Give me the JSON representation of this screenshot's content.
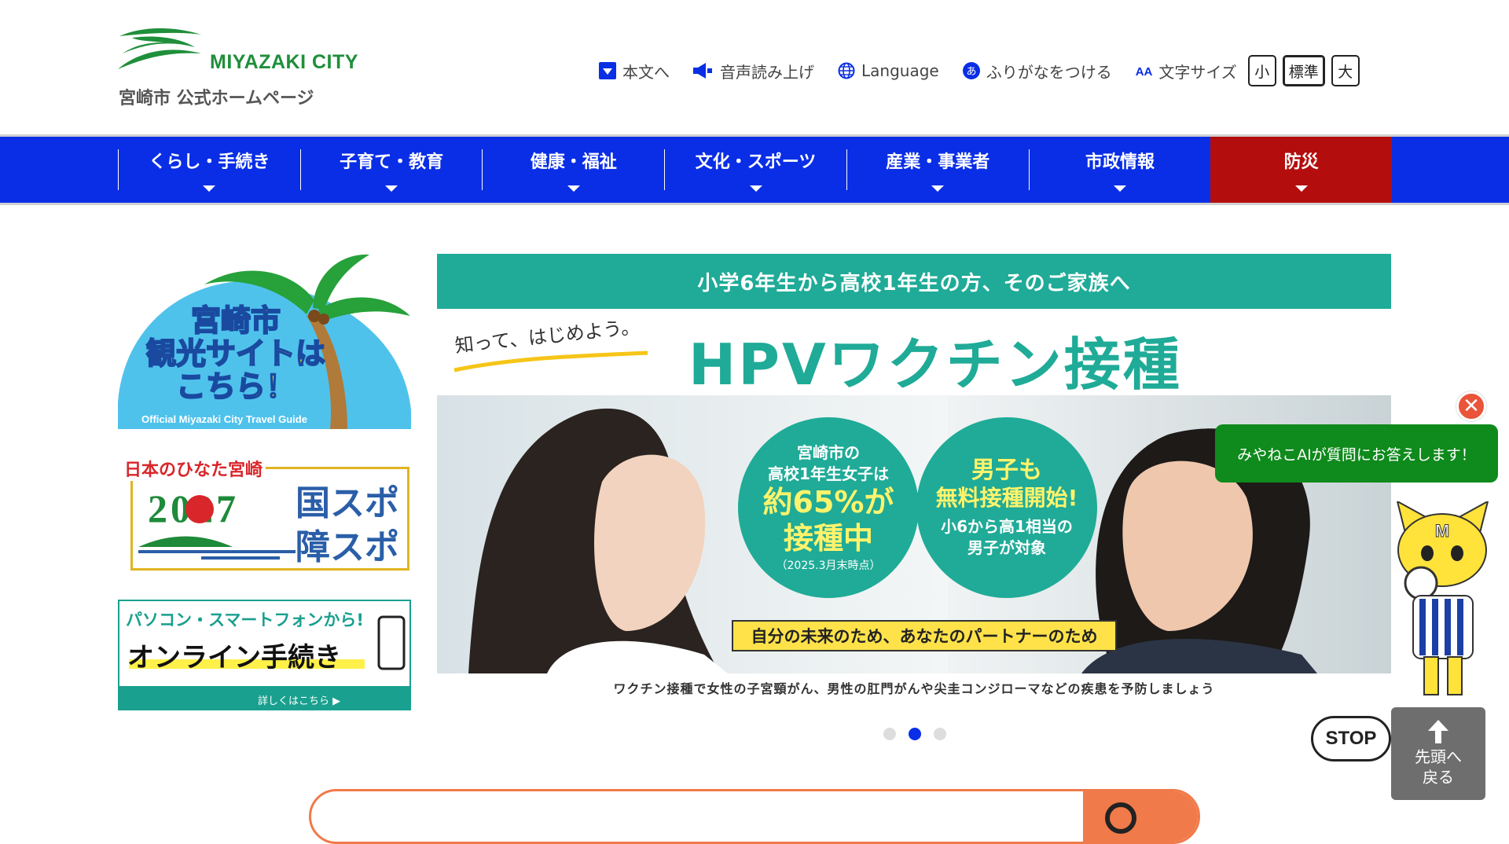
{
  "header": {
    "logo_en": "MIYAZAKI CITY",
    "logo_jp": "宮崎市 公式ホームページ",
    "utilities": [
      {
        "label": "本文へ",
        "icon": "skip-to-content-icon"
      },
      {
        "label": "音声読み上げ",
        "icon": "speaker-icon"
      },
      {
        "label": "Language",
        "icon": "globe-icon"
      },
      {
        "label": "ふりがなをつける",
        "icon": "furigana-icon"
      }
    ],
    "font_size": {
      "label": "文字サイズ",
      "icon_text": "AA",
      "options": [
        "小",
        "標準",
        "大"
      ]
    }
  },
  "nav": {
    "items": [
      "くらし・手続き",
      "子育て・教育",
      "健康・福祉",
      "文化・スポーツ",
      "産業・事業者",
      "市政情報",
      "防災"
    ]
  },
  "banners": {
    "travel": {
      "line1": "宮崎市",
      "line2": "観光サイトは",
      "line3": "こちら！",
      "sub": "Official Miyazaki City Travel Guide"
    },
    "sports": {
      "top": "日本のひなた宮崎",
      "year": "2027",
      "kokusupo": "国スポ",
      "shosupo": "障スポ"
    },
    "online": {
      "line1": "パソコン・スマートフォンから!",
      "line2": "オンライン手続き",
      "link": "詳しくはこちら ▶"
    }
  },
  "hero": {
    "topbar": "小学6年生から高校1年生の方、そのご家族へ",
    "tagline": "知って、はじめよう。",
    "title": "HPVワクチン接種",
    "circle1": {
      "line1": "宮崎市の",
      "line2": "高校1年生女子は",
      "big1": "約65%が",
      "big2": "接種中",
      "note": "（2025.3月末時点）"
    },
    "circle2": {
      "big1": "男子も",
      "big2": "無料接種開始!",
      "line1": "小6から高1相当の",
      "line2": "男子が対象"
    },
    "banner": "自分の未来のため、あなたのパートナーのため",
    "caption": "ワクチン接種で女性の子宮頸がん、男性の肛門がんや尖圭コンジローマなどの疾患を予防しましょう"
  },
  "slider": {
    "total": 3,
    "active_index": 2
  },
  "chat": {
    "message": "みやねこAIが質問にお答えします！",
    "close": "✕"
  },
  "controls": {
    "stop": "STOP",
    "totop_line1": "先頭へ",
    "totop_line2": "戻る"
  },
  "colors": {
    "nav": "#0a2ee6",
    "bousai": "#b40d0d",
    "accent_teal": "#1fab97",
    "chat_green": "#0f8a1c",
    "search_orange": "#f07a4a"
  }
}
